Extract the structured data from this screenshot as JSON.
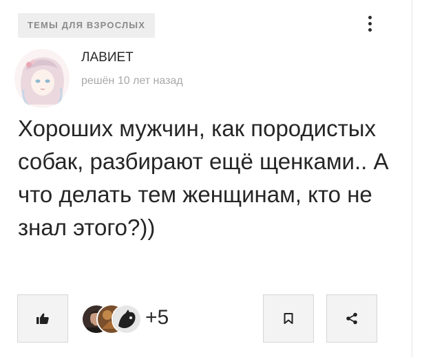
{
  "post": {
    "category": "ТЕМЫ ДЛЯ ВЗРОСЛЫХ",
    "author": {
      "name": "ЛАВИЕТ",
      "status": "решён 10 лет назад"
    },
    "text": "Хороших мужчин, как породистых собак, разбирают ещё щенками.. А что делать тем женщинам, кто не знал этого?))"
  },
  "actions": {
    "like_icon": "thumbs-up-icon",
    "reaction_count": "+5",
    "bookmark_icon": "bookmark-icon",
    "share_icon": "share-icon",
    "more_icon": "vertical-dots-icon"
  },
  "colors": {
    "text": "#262626",
    "muted": "#a8a8a8",
    "tag_bg": "#eeeeee",
    "button_bg": "#f3f3f3"
  }
}
